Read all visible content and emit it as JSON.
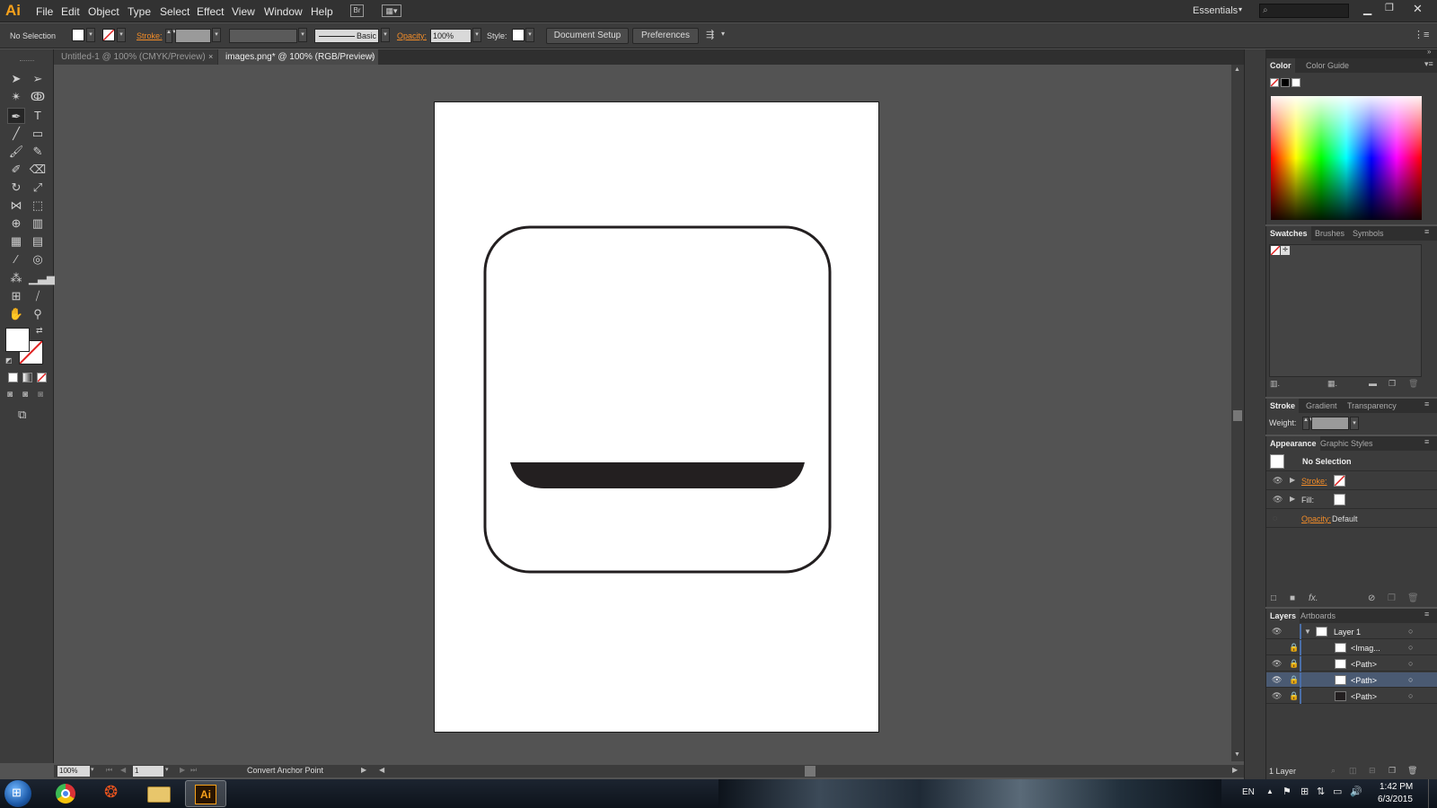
{
  "app": {
    "logo": "Ai"
  },
  "menu": {
    "items": [
      "File",
      "Edit",
      "Object",
      "Type",
      "Select",
      "Effect",
      "View",
      "Window",
      "Help"
    ]
  },
  "workspace": {
    "label": "Essentials",
    "search_placeholder": ""
  },
  "control_bar": {
    "selection_label": "No Selection",
    "stroke_label": "Stroke:",
    "brush_label": "Basic",
    "opacity_label": "Opacity:",
    "opacity_value": "100%",
    "style_label": "Style:",
    "document_setup": "Document Setup",
    "preferences": "Preferences"
  },
  "doc_tabs": [
    {
      "label": "Untitled-1 @ 100% (CMYK/Preview)",
      "active": false
    },
    {
      "label": "images.png* @ 100% (RGB/Preview)",
      "active": true
    }
  ],
  "status": {
    "zoom": "100%",
    "page": "1",
    "tool": "Convert Anchor Point"
  },
  "color_panel": {
    "tabs": [
      "Color",
      "Color Guide"
    ]
  },
  "swatches_panel": {
    "tabs": [
      "Swatches",
      "Brushes",
      "Symbols"
    ]
  },
  "stroke_panel": {
    "tabs": [
      "Stroke",
      "Gradient",
      "Transparency"
    ],
    "weight_label": "Weight:"
  },
  "appearance_panel": {
    "tabs": [
      "Appearance",
      "Graphic Styles"
    ],
    "title": "No Selection",
    "stroke_label": "Stroke:",
    "fill_label": "Fill:",
    "opacity_label": "Opacity:",
    "opacity_value": "Default"
  },
  "layers_panel": {
    "tabs": [
      "Layers",
      "Artboards"
    ],
    "layer_name": "Layer 1",
    "items": [
      "<Imag...",
      "<Path>",
      "<Path>",
      "<Path>"
    ],
    "footer": "1 Layer"
  },
  "taskbar": {
    "lang": "EN",
    "time": "1:42 PM",
    "date": "6/3/2015"
  },
  "colors": {
    "accent": "#f7a11b",
    "selection_blue": "#4b6fa8",
    "ui_dark": "#3c3c3c"
  }
}
